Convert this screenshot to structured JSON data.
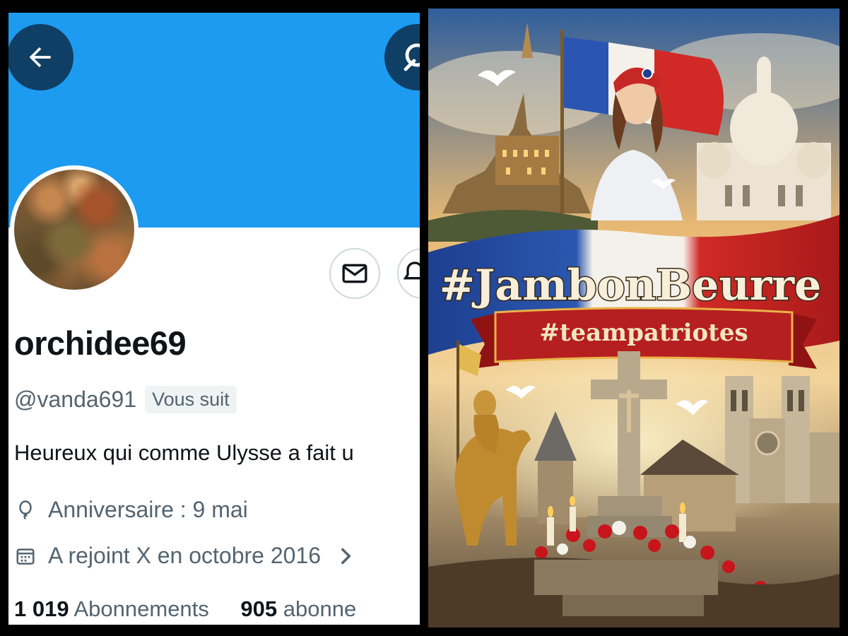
{
  "profile": {
    "display_name": "orchidee69",
    "handle": "@vanda691",
    "follows_you": "Vous suit",
    "bio": "Heureux qui comme Ulysse a fait u",
    "birthday": "Anniversaire : 9 mai",
    "joined": "A rejoint X en octobre 2016",
    "following_count": "1 019",
    "following_label": "Abonnements",
    "followers_count": "905",
    "followers_label": "abonne"
  },
  "icons": {
    "back": "arrow-left-icon",
    "grok": "grok-icon",
    "message": "envelope-icon",
    "notify": "bell-icon",
    "birthday": "balloon-icon",
    "joined": "calendar-icon",
    "chevron": "chevron-right-icon"
  },
  "colors": {
    "banner": "#1d9bf0",
    "round_button": "#0f3f64",
    "text_primary": "#0f1419",
    "text_secondary": "#536471",
    "poster_red": "#c0201f",
    "poster_blue": "#1d3f8f",
    "poster_gold": "#e9b24a"
  },
  "poster": {
    "title": "#JambonBeurre",
    "subtitle": "#teampatriotes"
  }
}
